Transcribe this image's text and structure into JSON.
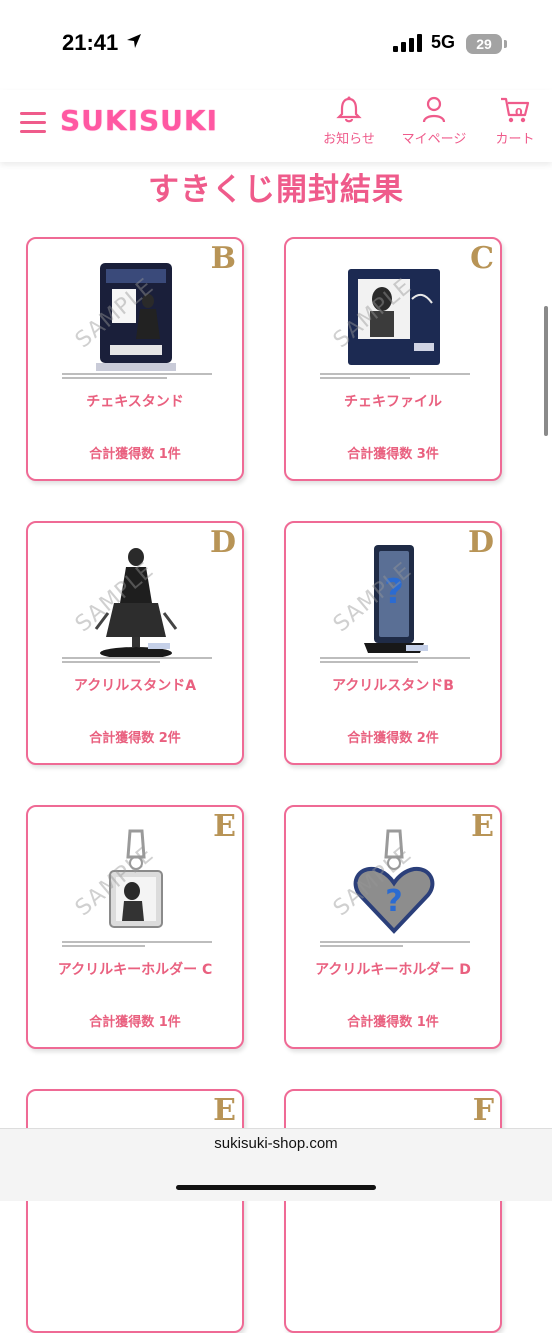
{
  "status": {
    "time": "21:41",
    "network": "5G",
    "battery": "29"
  },
  "header": {
    "logo": "SUKISUKI",
    "nav": [
      {
        "label": "お知らせ",
        "icon": "bell-icon"
      },
      {
        "label": "マイページ",
        "icon": "person-icon"
      },
      {
        "label": "カート",
        "icon": "cart-icon",
        "count": "0"
      }
    ]
  },
  "page": {
    "title": "すきくじ開封結果"
  },
  "watermark": "SAMPLE",
  "cards": [
    {
      "grade": "B",
      "name": "チェキスタンド",
      "count": "合計獲得数 1件"
    },
    {
      "grade": "C",
      "name": "チェキファイル",
      "count": "合計獲得数 3件"
    },
    {
      "grade": "D",
      "name": "アクリルスタンドA",
      "count": "合計獲得数 2件"
    },
    {
      "grade": "D",
      "name": "アクリルスタンドB",
      "count": "合計獲得数 2件"
    },
    {
      "grade": "E",
      "name": "アクリルキーホルダー C",
      "count": "合計獲得数 1件"
    },
    {
      "grade": "E",
      "name": "アクリルキーホルダー D",
      "count": "合計獲得数 1件"
    },
    {
      "grade": "E",
      "name": "",
      "count": ""
    },
    {
      "grade": "F",
      "name": "",
      "count": ""
    }
  ],
  "browser": {
    "url": "sukisuki-shop.com"
  },
  "colors": {
    "accent": "#ef5b8b",
    "grade": "#b89456",
    "card_border": "#ef6a95"
  }
}
